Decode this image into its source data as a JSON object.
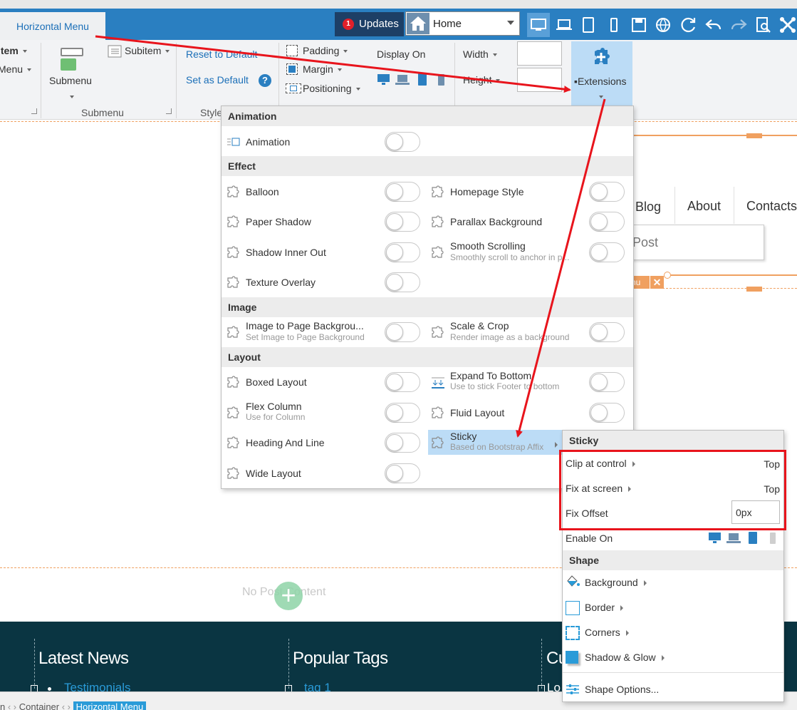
{
  "topbar": {
    "active_tab": "Horizontal Menu",
    "updates_label": "Updates",
    "updates_count": "1",
    "page_select_value": "Home"
  },
  "ribbon": {
    "item_label": "Item",
    "menu_label": "Menu",
    "submenu_label": "Submenu",
    "subitem_label": "Subitem",
    "submenu_group": "Submenu",
    "reset_default": "Reset to Default",
    "set_default": "Set as Default",
    "help_glyph": "?",
    "style_group": "Style",
    "padding": "Padding",
    "margin": "Margin",
    "positioning": "Positioning",
    "display_on": "Display On",
    "width": "Width",
    "height": "Height",
    "extensions": "Extensions"
  },
  "canvas": {
    "nav": [
      "Blog",
      "About",
      "Contacts"
    ],
    "post_placeholder": "Post",
    "menu_tag": "nu",
    "menu_tag_close": "✕",
    "no_post_content": "No Post Content",
    "add_glyph": "+"
  },
  "footer": {
    "col1_title": "Latest News",
    "col1_link": "Testimonials",
    "col2_title": "Popular Tags",
    "col2_link": "tag 1",
    "col3_title": "Cu",
    "col3_link": "Lo"
  },
  "statusbar": {
    "crumb_0": "n",
    "crumb_1": "Container",
    "crumb_2": "Horizontal Menu"
  },
  "extensions": {
    "sections": {
      "animation": "Animation",
      "effect": "Effect",
      "image": "Image",
      "layout": "Layout"
    },
    "animation": {
      "label": "Animation",
      "on": false
    },
    "balloon": {
      "label": "Balloon",
      "on": false
    },
    "homepage_style": {
      "label": "Homepage Style",
      "on": false
    },
    "paper_shadow": {
      "label": "Paper Shadow",
      "on": false
    },
    "parallax_background": {
      "label": "Parallax Background",
      "on": false
    },
    "shadow_inner_out": {
      "label": "Shadow Inner Out",
      "on": false
    },
    "smooth_scrolling": {
      "label": "Smooth Scrolling",
      "desc": "Smoothly scroll to anchor in p...",
      "on": false
    },
    "texture_overlay": {
      "label": "Texture Overlay",
      "on": false
    },
    "image_to_page_bg": {
      "label": "Image to Page Backgrou...",
      "desc": "Set Image to Page Background",
      "on": false
    },
    "scale_crop": {
      "label": "Scale & Crop",
      "desc": "Render image as a background",
      "on": false
    },
    "boxed_layout": {
      "label": "Boxed Layout",
      "on": false
    },
    "expand_to_bottom": {
      "label": "Expand To Bottom",
      "desc": "Use to stick Footer to bottom",
      "on": false
    },
    "flex_column": {
      "label": "Flex Column",
      "desc": "Use for Column",
      "on": false
    },
    "fluid_layout": {
      "label": "Fluid Layout",
      "on": false
    },
    "heading_and_line": {
      "label": "Heading And Line",
      "on": false
    },
    "sticky": {
      "label": "Sticky",
      "desc": "Based on Bootstrap Affix"
    },
    "wide_layout": {
      "label": "Wide Layout",
      "on": false
    }
  },
  "sticky_menu": {
    "title": "Sticky",
    "clip_label": "Clip at control",
    "clip_value": "Top",
    "fix_label": "Fix at screen",
    "fix_value": "Top",
    "offset_label": "Fix Offset",
    "offset_value": "0px",
    "enable_label": "Enable On",
    "shape_title": "Shape",
    "background": "Background",
    "border": "Border",
    "corners": "Corners",
    "shadow_glow": "Shadow & Glow",
    "shape_options": "Shape Options..."
  },
  "colors": {
    "accent_blue": "#2a7fc1",
    "highlight_blue": "#bcdcf6",
    "annotation_red": "#e8141c",
    "footer_bg": "#0a3542",
    "dashed_orange": "#f0a060"
  },
  "icons": {
    "home": "home-icon",
    "updates": "notification-badge",
    "extensions": "puzzle-plus-icon",
    "devices": [
      "desktop-icon",
      "laptop-icon",
      "tablet-icon",
      "phone-icon"
    ],
    "tools": [
      "save-icon",
      "globe-icon",
      "refresh-icon",
      "undo-icon",
      "redo-icon",
      "preview-icon",
      "joomla-icon"
    ]
  }
}
